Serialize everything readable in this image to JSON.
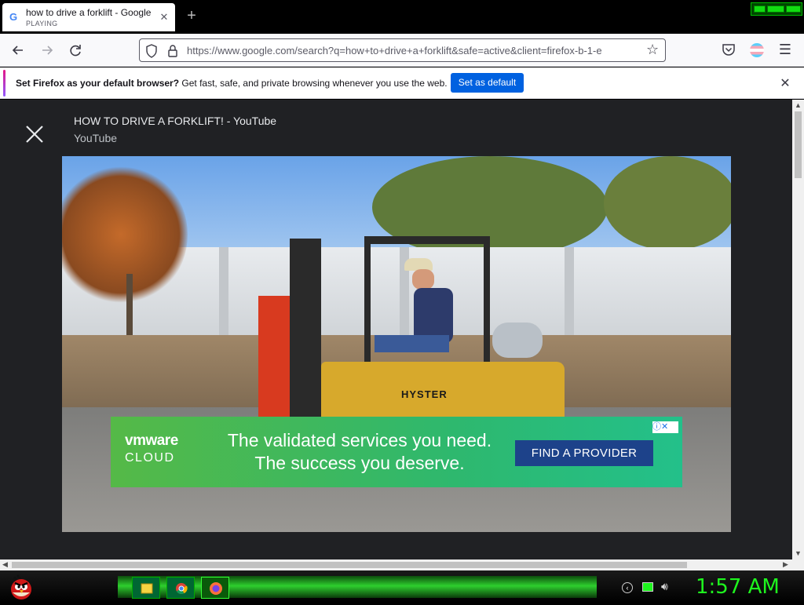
{
  "browser": {
    "tab": {
      "title": "how to drive a forklift - Google",
      "status": "PLAYING",
      "favicon": "G"
    },
    "new_tab_label": "+",
    "url": "https://www.google.com/search?q=how+to+drive+a+forklift&safe=active&client=firefox-b-1-e",
    "icons": {
      "back": "back-arrow-icon",
      "forward": "forward-arrow-icon",
      "reload": "reload-icon",
      "shield": "tracking-shield-icon",
      "lock": "lock-icon",
      "bookmark": "star-icon",
      "pocket": "pocket-icon",
      "account": "account-icon",
      "menu": "hamburger-menu-icon"
    }
  },
  "notification": {
    "bold": "Set Firefox as your default browser?",
    "text": " Get fast, safe, and private browsing whenever you use the web.",
    "button_label": "Set as default",
    "close_glyph": "✕"
  },
  "viewer": {
    "title": "HOW TO DRIVE A FORKLIFT! - YouTube",
    "source": "YouTube",
    "video_text": "HYSTER"
  },
  "ad": {
    "brand_line1": "vmware",
    "brand_line2": "CLOUD",
    "headline1": "The validated services you need.",
    "headline2": "The success you deserve.",
    "cta": "FIND A PROVIDER",
    "adchoices": "ⓘ✕"
  },
  "taskbar": {
    "clock": "1:57 AM",
    "accent_color": "#1ef51e"
  }
}
